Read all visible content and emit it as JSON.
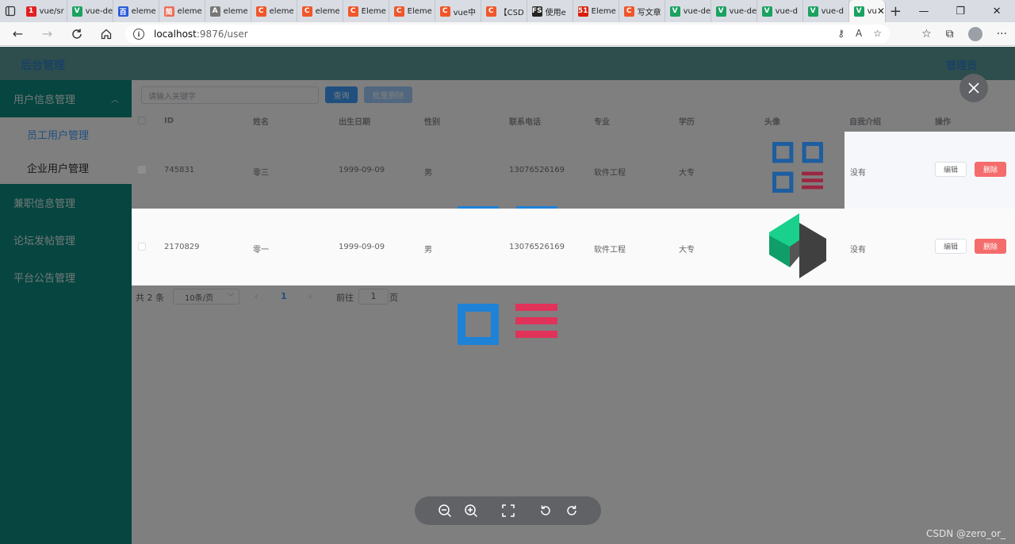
{
  "browser": {
    "tabs": [
      {
        "label": "vue/sr",
        "fav": "1",
        "color": "#e02020"
      },
      {
        "label": "vue-de",
        "fav": "V",
        "color": "#1aa260"
      },
      {
        "label": "eleme",
        "fav": "百",
        "color": "#2a5cd8"
      },
      {
        "label": "eleme",
        "fav": "简",
        "color": "#ea6f5a"
      },
      {
        "label": "eleme",
        "fav": "A",
        "color": "#777777"
      },
      {
        "label": "eleme",
        "fav": "C",
        "color": "#f0562a"
      },
      {
        "label": "eleme",
        "fav": "C",
        "color": "#f0562a"
      },
      {
        "label": "Eleme",
        "fav": "C",
        "color": "#f0562a"
      },
      {
        "label": "Eleme",
        "fav": "C",
        "color": "#f0562a"
      },
      {
        "label": "vue中",
        "fav": "C",
        "color": "#f0562a"
      },
      {
        "label": "【CSD",
        "fav": "C",
        "color": "#f0562a"
      },
      {
        "label": "使用e",
        "fav": "FS",
        "color": "#222222"
      },
      {
        "label": "Eleme",
        "fav": "51",
        "color": "#d81e06"
      },
      {
        "label": "写文章",
        "fav": "C",
        "color": "#f0562a"
      },
      {
        "label": "vue-de",
        "fav": "V",
        "color": "#1aa260"
      },
      {
        "label": "vue-de",
        "fav": "V",
        "color": "#1aa260"
      },
      {
        "label": "vue-d",
        "fav": "V",
        "color": "#1aa260"
      },
      {
        "label": "vue-d",
        "fav": "V",
        "color": "#1aa260"
      }
    ],
    "active_tab": {
      "label": "vu",
      "fav": "V",
      "color": "#1aa260"
    },
    "url_host": "localhost",
    "url_path": ":9876/user"
  },
  "app": {
    "brand": "后台管理",
    "admin": "管理员",
    "menu": {
      "group_user": "用户信息管理",
      "sub_staff": "员工用户管理",
      "sub_company": "企业用户管理",
      "group_job": "兼职信息管理",
      "group_forum": "论坛发帖管理",
      "group_notice": "平台公告管理"
    },
    "toolbar": {
      "search_placeholder": "请输入关键字",
      "query_label": "查询",
      "batch_delete_label": "批量删除"
    },
    "table": {
      "headers": [
        "ID",
        "姓名",
        "出生日期",
        "性别",
        "联系电话",
        "专业",
        "学历",
        "头像",
        "自我介绍",
        "操作"
      ],
      "rows": [
        {
          "id": "745831",
          "name": "零三",
          "birth": "1999-09-09",
          "gender": "男",
          "phone": "13076526169",
          "major": "软件工程",
          "edu": "大专",
          "intro": "没有"
        },
        {
          "id": "2170829",
          "name": "零一",
          "birth": "1999-09-09",
          "gender": "男",
          "phone": "13076526169",
          "major": "软件工程",
          "edu": "大专",
          "intro": "没有"
        }
      ],
      "edit_label": "编辑",
      "delete_label": "删除"
    },
    "pager": {
      "total": "共 2 条",
      "page_size": "10条/页",
      "current": "1",
      "goto_prefix": "前往",
      "goto_value": "1",
      "goto_suffix": "页"
    }
  },
  "colors": {
    "primary": "#409eff",
    "danger": "#f56c6c",
    "sidebar": "#0d8a80"
  },
  "watermark": "CSDN @zero_or_"
}
